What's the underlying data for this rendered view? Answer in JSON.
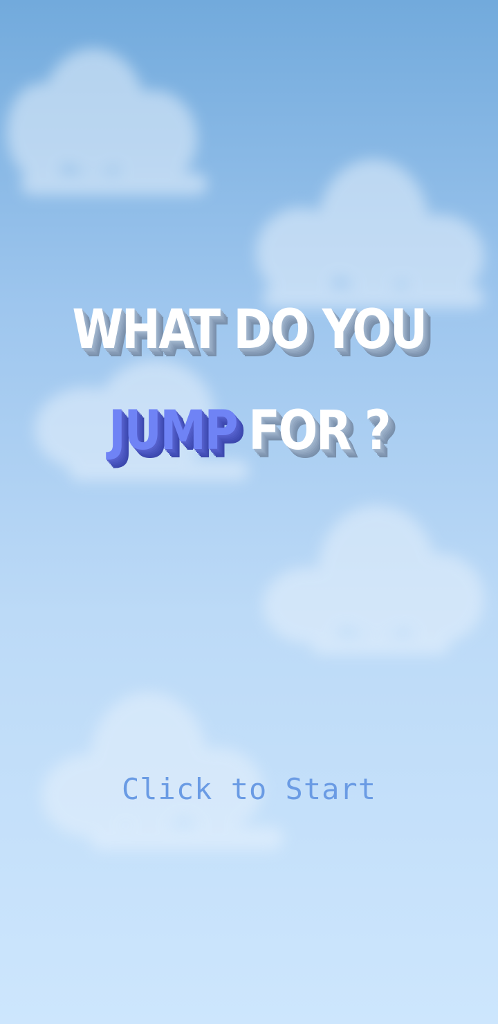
{
  "title": {
    "line1": "WHAT DO YOU",
    "line2_highlight": "JUMP",
    "line2_rest": "FOR ?"
  },
  "start_prompt": "Click to Start",
  "colors": {
    "sky_top": "#72aadc",
    "sky_bottom": "#cde6fd",
    "title_text": "#ffffff",
    "accent": "#6f83f5",
    "prompt": "#6a9be4"
  }
}
